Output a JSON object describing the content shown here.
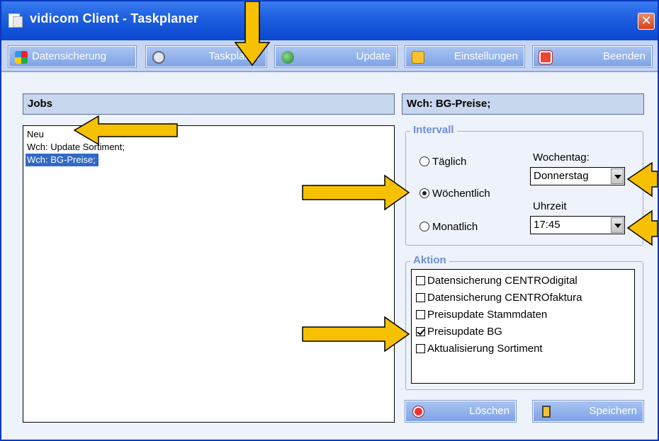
{
  "window": {
    "title": "vidicom Client - Taskplaner",
    "close_glyph": "✕"
  },
  "toolbar": {
    "items": [
      {
        "label": "Datensicherung",
        "icon": "backup-icon"
      },
      {
        "label": "Taskplaner",
        "icon": "clock-icon"
      },
      {
        "label": "Update",
        "icon": "globe-icon"
      },
      {
        "label": "Einstellungen",
        "icon": "settings-checkmark-icon"
      },
      {
        "label": "Beenden",
        "icon": "exit-icon"
      }
    ]
  },
  "jobs": {
    "header": "Jobs",
    "items": [
      "Neu",
      "Wch: Update Sortiment;",
      "Wch: BG-Preise;"
    ],
    "selected_index": 2
  },
  "detail": {
    "header": "Wch: BG-Preise;",
    "intervall": {
      "title": "Intervall",
      "options": [
        "Täglich",
        "Wöchentlich",
        "Monatlich"
      ],
      "selected": "Wöchentlich",
      "wochentag_label": "Wochentag:",
      "wochentag_value": "Donnerstag",
      "uhrzeit_label": "Uhrzeit",
      "uhrzeit_value": "17:45"
    },
    "aktion": {
      "title": "Aktion",
      "items": [
        {
          "label": "Datensicherung CENTROdigital",
          "checked": false
        },
        {
          "label": "Datensicherung CENTROfaktura",
          "checked": false
        },
        {
          "label": "Preisupdate Stammdaten",
          "checked": false
        },
        {
          "label": "Preisupdate BG",
          "checked": true
        },
        {
          "label": "Aktualisierung Sortiment",
          "checked": false
        }
      ]
    }
  },
  "buttons": {
    "delete_label": "Löschen",
    "save_label": "Speichern"
  },
  "colors": {
    "titlebar": "#0a48d0",
    "toolbar_button": "#7fa3e6",
    "selection": "#316ac5",
    "annotation_arrow": "#f7c000",
    "close": "#d2441c",
    "group_title": "#6d8fd6"
  }
}
